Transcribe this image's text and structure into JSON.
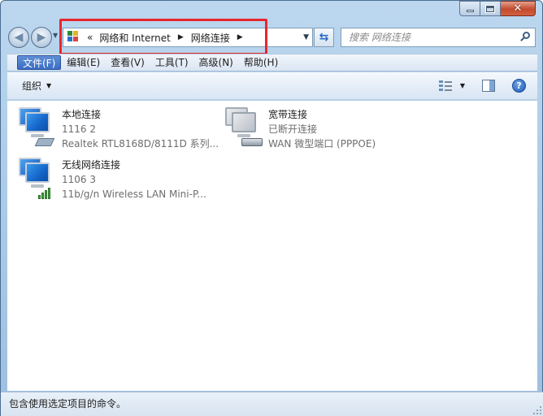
{
  "window": {
    "controls": {
      "minimize": "minimize",
      "maximize": "maximize",
      "close": "close"
    }
  },
  "address": {
    "overflow_glyph": "«",
    "breadcrumbs": [
      "网络和 Internet",
      "网络连接"
    ]
  },
  "search": {
    "placeholder": "搜索 网络连接"
  },
  "menu": {
    "items": [
      "文件(F)",
      "编辑(E)",
      "查看(V)",
      "工具(T)",
      "高级(N)",
      "帮助(H)"
    ]
  },
  "command_bar": {
    "organize_label": "组织"
  },
  "connections": [
    {
      "name": "本地连接",
      "status": "1116  2",
      "device": "Realtek RTL8168D/8111D 系列...",
      "icon": "wired-network-icon"
    },
    {
      "name": "宽带连接",
      "status": "已断开连接",
      "device": "WAN 微型端口 (PPPOE)",
      "icon": "broadband-icon"
    },
    {
      "name": "无线网络连接",
      "status": "1106  3",
      "device": "11b/g/n  Wireless LAN Mini-P...",
      "icon": "wireless-network-icon"
    }
  ],
  "status_bar": {
    "text": "包含使用选定项目的命令。"
  },
  "colors": {
    "highlight_box": "#e8262d",
    "frame": "#a8c8e6",
    "accent": "#3a6ec4"
  }
}
